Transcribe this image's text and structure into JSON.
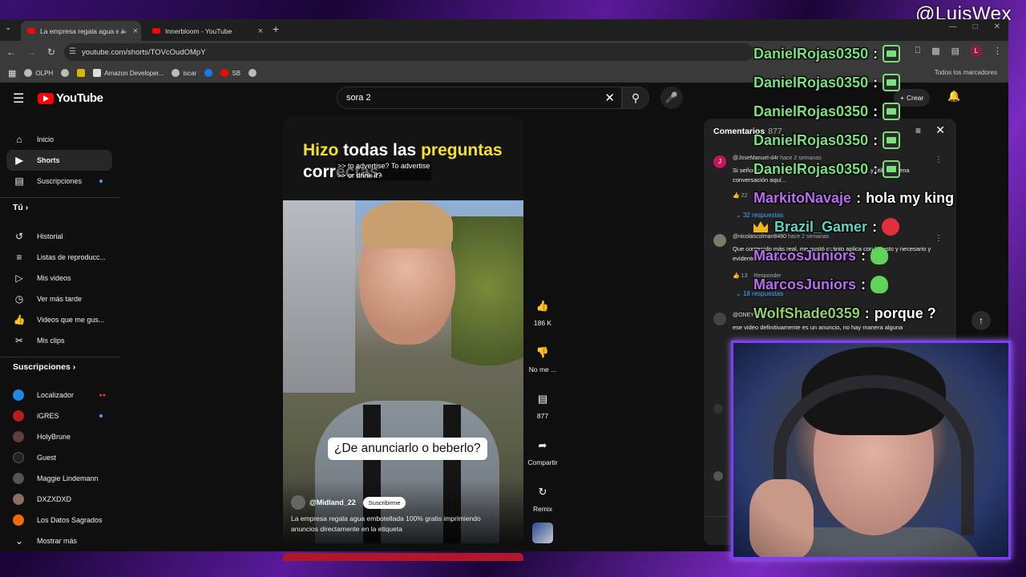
{
  "streamer_tag": "@LuisWex",
  "browser": {
    "tabs": [
      {
        "title": "La empresa regala agua embotellada",
        "active": true
      },
      {
        "title": "Innerbloom - YouTube",
        "active": false
      }
    ],
    "url": "youtube.com/shorts/TOVcOudOMpY",
    "bookmarks": [
      "OLPH",
      "",
      "Amazon Developer...",
      "iscar",
      "",
      "SB",
      ""
    ],
    "bookmarks_right": "Todos los marcadores"
  },
  "youtube": {
    "logo": "YouTube",
    "search_value": "sora 2",
    "create_label": "Crear",
    "sidebar": {
      "main": [
        {
          "label": "Inicio",
          "icon": "home-icon"
        },
        {
          "label": "Shorts",
          "icon": "shorts-icon",
          "selected": true
        },
        {
          "label": "Suscripciones",
          "icon": "subscriptions-icon"
        }
      ],
      "you_header": "Tú",
      "you": [
        {
          "label": "Historial",
          "icon": "history-icon"
        },
        {
          "label": "Listas de reproducc...",
          "icon": "playlist-icon"
        },
        {
          "label": "Mis videos",
          "icon": "my-videos-icon"
        },
        {
          "label": "Ver más tarde",
          "icon": "watch-later-icon"
        },
        {
          "label": "Videos que me gus...",
          "icon": "liked-icon"
        },
        {
          "label": "Mis clips",
          "icon": "clips-icon"
        }
      ],
      "subs_header": "Suscripciones",
      "subs": [
        {
          "label": "Localizador",
          "color": "#1e88e5"
        },
        {
          "label": "iGRES",
          "color": "#b71c1c"
        },
        {
          "label": "HolyBrune",
          "color": "#5d4037"
        },
        {
          "label": "Guest",
          "color": "#222222"
        },
        {
          "label": "Maggie Lindemann",
          "color": "#555555"
        },
        {
          "label": "DXZXDXD",
          "color": "#8d6e63"
        },
        {
          "label": "Los Datos Sagrados",
          "color": "#ef6c00"
        }
      ],
      "show_more": "Mostrar más"
    },
    "short": {
      "caption_w1": "Hizo",
      "caption_w2": "todas las",
      "caption_w3": "preguntas",
      "caption_w4": "correctas.",
      "sub_en_1": ">> to advertise? To advertise",
      "sub_en_2": ">> or drink it?",
      "bubble": "¿De anunciarlo o beberlo?",
      "channel": "@Midland_22",
      "subscribe": "Suscribirme",
      "description": "La empresa regala agua embotellada 100% gratis imprimiendo anuncios directamente en la etiqueta"
    },
    "actions": {
      "likes": "186 K",
      "dislike": "No me ...",
      "comments": "877",
      "share": "Compartir",
      "remix": "Remix"
    },
    "comments_panel": {
      "title": "Comentarios",
      "count": "877",
      "items": [
        {
          "author": "@JoseManuel-d4r",
          "ago": "hace 2 semanas",
          "text": "Si señor, preguntas realistas, respuestas honestas..y útiles..buena conversación aquí...",
          "likes": "22",
          "replies": "32 respuestas",
          "avatar_color": "#c2185b"
        },
        {
          "author": "@nicolascolman8460",
          "ago": "hace 2 semanas",
          "text": "Que contenido más real, me gustó cuánto aplica con lo justo y necesario y evidentemente todos entienden",
          "likes": "13",
          "replies": "18 respuestas",
          "reply_label": "Responder",
          "avatar_color": "#7a7a6a"
        },
        {
          "author": "@ONEYTLEWIS",
          "ago": "",
          "text": "ese video definitivamente es un anuncio, no hay manera alguna",
          "likes": "",
          "replies": "",
          "avatar_color": "#444444"
        }
      ]
    }
  },
  "chat": [
    {
      "user": "DanielRojas0350",
      "color": "#7be07b",
      "msg": "",
      "emote": "tbox"
    },
    {
      "user": "DanielRojas0350",
      "color": "#7be07b",
      "msg": "",
      "emote": "tbox"
    },
    {
      "user": "DanielRojas0350",
      "color": "#7be07b",
      "msg": "",
      "emote": "tbox"
    },
    {
      "user": "DanielRojas0350",
      "color": "#7be07b",
      "msg": "",
      "emote": "tbox"
    },
    {
      "user": "DanielRojas0350",
      "color": "#7be07b",
      "msg": "",
      "emote": "tbox"
    },
    {
      "user": "MarkitoNavaje",
      "color": "#b86cf0",
      "msg": "hola my king",
      "emote": ""
    },
    {
      "user": "Brazil_Gamer",
      "color": "#5fd3c4",
      "msg": "",
      "emote": "red",
      "crown": true
    },
    {
      "user": "MarcosJuniors",
      "color": "#b86cf0",
      "msg": "",
      "emote": "green"
    },
    {
      "user": "MarcosJuniors",
      "color": "#b86cf0",
      "msg": "",
      "emote": "green"
    },
    {
      "user": "WolfShade0359",
      "color": "#8fd06a",
      "msg": "porque ?",
      "emote": ""
    }
  ],
  "colors": {
    "accent": "#ff0000",
    "frame": "#7e3cff",
    "link": "#3ea6ff"
  }
}
